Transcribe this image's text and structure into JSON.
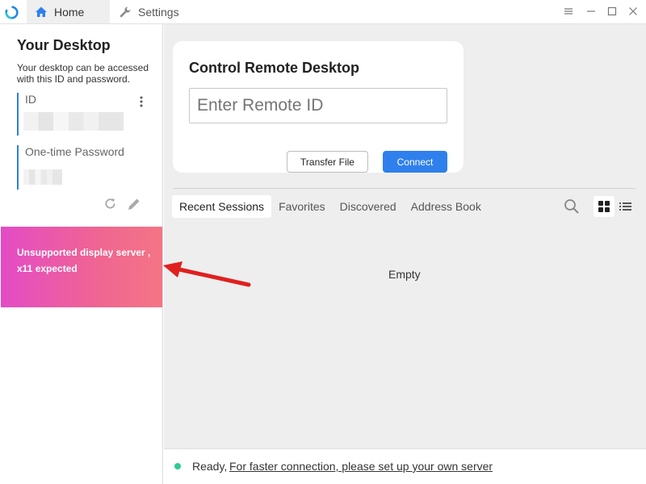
{
  "titlebar": {
    "tabs": [
      {
        "label": "Home",
        "icon": "home-icon"
      },
      {
        "label": "Settings",
        "icon": "wrench-icon"
      }
    ],
    "window_controls": [
      "menu-icon",
      "minimize-icon",
      "maximize-icon",
      "close-icon"
    ]
  },
  "left": {
    "title": "Your Desktop",
    "description": "Your desktop can be accessed with this ID and password.",
    "id_label": "ID",
    "password_label": "One-time Password",
    "warning": "Unsupported display server , x11 expected"
  },
  "remote": {
    "title": "Control Remote Desktop",
    "placeholder": "Enter Remote ID",
    "transfer_label": "Transfer File",
    "connect_label": "Connect"
  },
  "sessions": {
    "tabs": [
      "Recent Sessions",
      "Favorites",
      "Discovered",
      "Address Book"
    ],
    "active_tab": "Recent Sessions",
    "view_mode": "grid",
    "empty_text": "Empty"
  },
  "status": {
    "ready": "Ready,",
    "link": "For faster connection, please set up your own server"
  },
  "colors": {
    "accent": "#2f80ed",
    "status_dot": "#2ecc8f",
    "warning_gradient_start": "#e44bc6",
    "warning_gradient_end": "#f47585",
    "annotation_arrow": "#e02020"
  }
}
